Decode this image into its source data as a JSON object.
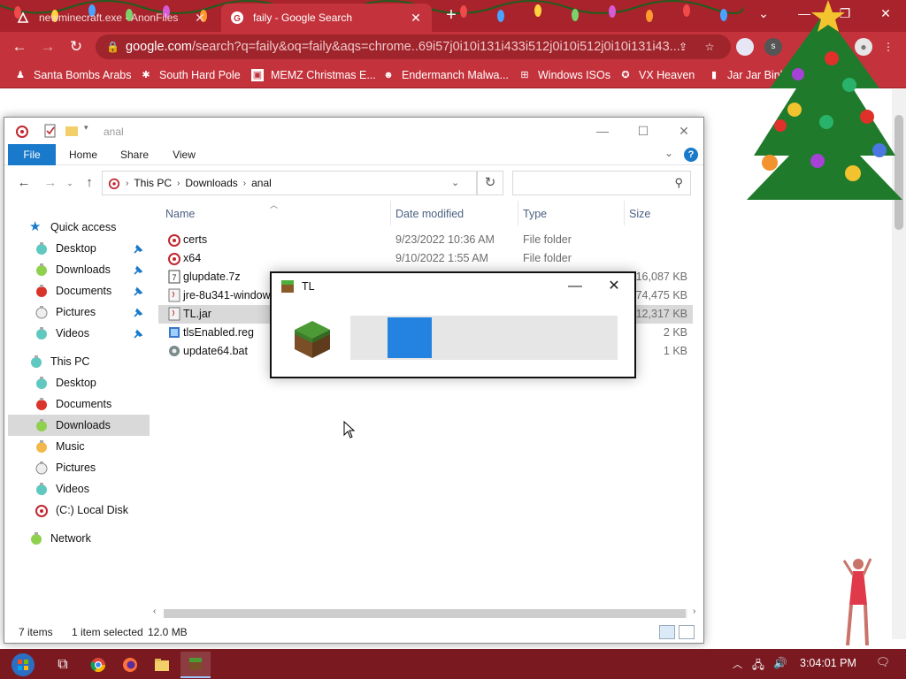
{
  "browser": {
    "tabs": [
      {
        "label": "newminecraft.exe - AnonFiles",
        "active": false
      },
      {
        "label": "faily - Google Search",
        "active": true
      }
    ],
    "new_tab": "+",
    "url_host": "google.com",
    "url_path": "/search?q=faily&oq=faily&aqs=chrome..69i57j0i10i131i433i512j0i10i512j0i10i131i43...",
    "bookmarks": [
      "Santa Bombs Arabs",
      "South Hard Pole",
      "MEMZ Christmas E...",
      "Endermanch Malwa...",
      "Windows ISOs",
      "VX Heaven",
      "Jar Jar Binks"
    ],
    "accent": "#c4333c"
  },
  "explorer": {
    "title": "anal",
    "ribbon": {
      "file": "File",
      "home": "Home",
      "share": "Share",
      "view": "View",
      "help": "?"
    },
    "breadcrumb": [
      "This PC",
      "Downloads",
      "anal"
    ],
    "search_placeholder": "",
    "nav": {
      "quick_access": "Quick access",
      "quick_items": [
        "Desktop",
        "Downloads",
        "Documents",
        "Pictures",
        "Videos"
      ],
      "this_pc": "This PC",
      "pc_items": [
        "Desktop",
        "Documents",
        "Downloads",
        "Music",
        "Pictures",
        "Videos",
        "(C:) Local Disk"
      ],
      "network": "Network"
    },
    "columns": {
      "name": "Name",
      "date": "Date modified",
      "type": "Type",
      "size": "Size"
    },
    "files": [
      {
        "name": "certs",
        "date": "9/23/2022 10:36 AM",
        "type": "File folder",
        "size": ""
      },
      {
        "name": "x64",
        "date": "9/10/2022 1:55 AM",
        "type": "File folder",
        "size": ""
      },
      {
        "name": "glupdate.7z",
        "date": "",
        "type": "",
        "size": "16,087 KB"
      },
      {
        "name": "jre-8u341-windows",
        "date": "",
        "type": "",
        "size": "74,475 KB"
      },
      {
        "name": "TL.jar",
        "date": "",
        "type": "",
        "size": "12,317 KB"
      },
      {
        "name": "tlsEnabled.reg",
        "date": "",
        "type": "",
        "size": "2 KB"
      },
      {
        "name": "update64.bat",
        "date": "",
        "type": "",
        "size": "1 KB"
      }
    ],
    "status": {
      "count": "7 items",
      "selected": "1 item selected",
      "size": "12.0 MB"
    }
  },
  "dialog": {
    "title": "TL",
    "minimize": "—",
    "close": "✕",
    "progress_marquee_position": 0.14
  },
  "taskbar": {
    "clock": "3:04:01 PM"
  }
}
